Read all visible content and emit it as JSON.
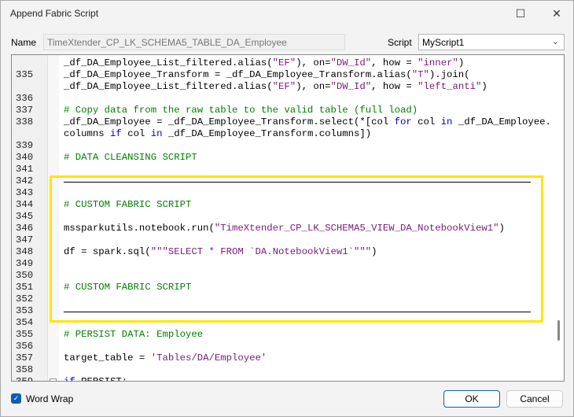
{
  "window": {
    "title": "Append Fabric Script"
  },
  "form": {
    "name_label": "Name",
    "name_value": "TimeXtender_CP_LK_SCHEMA5_TABLE_DA_Employee",
    "script_label": "Script",
    "script_value": "MyScript1"
  },
  "editor": {
    "rows": [
      {
        "n": "",
        "s": [
          [
            "_df_DA_Employee_List_filtered.alias(",
            "plain"
          ],
          [
            "\"EF\"",
            "str"
          ],
          [
            "), on=",
            "plain"
          ],
          [
            "\"DW_Id\"",
            "str"
          ],
          [
            ", how = ",
            "plain"
          ],
          [
            "\"inner\"",
            "str"
          ],
          [
            ")",
            "plain"
          ]
        ]
      },
      {
        "n": "335",
        "s": [
          [
            "_df_DA_Employee_Transform = _df_DA_Employee_Transform.alias(",
            "plain"
          ],
          [
            "\"T\"",
            "str"
          ],
          [
            ").join(",
            "plain"
          ]
        ]
      },
      {
        "n": "",
        "s": [
          [
            "_df_DA_Employee_List_filtered.alias(",
            "plain"
          ],
          [
            "\"EF\"",
            "str"
          ],
          [
            "), on=",
            "plain"
          ],
          [
            "\"DW_Id\"",
            "str"
          ],
          [
            ", how = ",
            "plain"
          ],
          [
            "\"left_anti\"",
            "str"
          ],
          [
            ")",
            "plain"
          ]
        ]
      },
      {
        "n": "336",
        "s": []
      },
      {
        "n": "337",
        "s": [
          [
            "# Copy data from the raw table to the valid table (full load)",
            "com"
          ]
        ]
      },
      {
        "n": "338",
        "s": [
          [
            "_df_DA_Employee = _df_DA_Employee_Transform.select(*[col ",
            "plain"
          ],
          [
            "for",
            "kw"
          ],
          [
            " col ",
            "plain"
          ],
          [
            "in",
            "kw"
          ],
          [
            " _df_DA_Employee.",
            "plain"
          ]
        ]
      },
      {
        "n": "",
        "s": [
          [
            "columns ",
            "plain"
          ],
          [
            "if",
            "kw"
          ],
          [
            " col ",
            "plain"
          ],
          [
            "in",
            "kw"
          ],
          [
            " _df_DA_Employee_Transform.columns])",
            "plain"
          ]
        ]
      },
      {
        "n": "339",
        "s": []
      },
      {
        "n": "340",
        "s": [
          [
            "# DATA CLEANSING SCRIPT",
            "com"
          ]
        ]
      },
      {
        "n": "341",
        "s": []
      },
      {
        "n": "342",
        "hr": true,
        "s": []
      },
      {
        "n": "343",
        "s": []
      },
      {
        "n": "344",
        "s": [
          [
            "# CUSTOM FABRIC SCRIPT",
            "com"
          ]
        ]
      },
      {
        "n": "345",
        "s": []
      },
      {
        "n": "346",
        "s": [
          [
            "mssparkutils.notebook.run(",
            "plain"
          ],
          [
            "\"TimeXtender_CP_LK_SCHEMA5_VIEW_DA_NotebookView1\"",
            "str"
          ],
          [
            ")",
            "plain"
          ]
        ]
      },
      {
        "n": "347",
        "s": []
      },
      {
        "n": "348",
        "s": [
          [
            "df = spark.sql(",
            "plain"
          ],
          [
            "\"\"\"SELECT * FROM `DA.NotebookView1`\"\"\"",
            "str"
          ],
          [
            ")",
            "plain"
          ]
        ]
      },
      {
        "n": "349",
        "s": []
      },
      {
        "n": "350",
        "s": []
      },
      {
        "n": "351",
        "s": [
          [
            "# CUSTOM FABRIC SCRIPT",
            "com"
          ]
        ]
      },
      {
        "n": "352",
        "s": []
      },
      {
        "n": "353",
        "hr": true,
        "s": []
      },
      {
        "n": "354",
        "s": []
      },
      {
        "n": "355",
        "s": [
          [
            "# PERSIST DATA: Employee",
            "com"
          ]
        ]
      },
      {
        "n": "356",
        "s": []
      },
      {
        "n": "357",
        "s": [
          [
            "target_table = ",
            "plain"
          ],
          [
            "'Tables/DA/Employee'",
            "str"
          ]
        ]
      },
      {
        "n": "358",
        "s": []
      },
      {
        "n": "359",
        "fold": true,
        "s": [
          [
            "if",
            "kw"
          ],
          [
            " PERSIST:",
            "plain"
          ]
        ]
      }
    ]
  },
  "footer": {
    "word_wrap_label": "Word Wrap",
    "word_wrap_checked": true,
    "ok_label": "OK",
    "cancel_label": "Cancel"
  },
  "colors": {
    "highlight": "#ffe500",
    "string": "#7a1a7a",
    "comment": "#008000",
    "keyword": "#0000cc"
  }
}
